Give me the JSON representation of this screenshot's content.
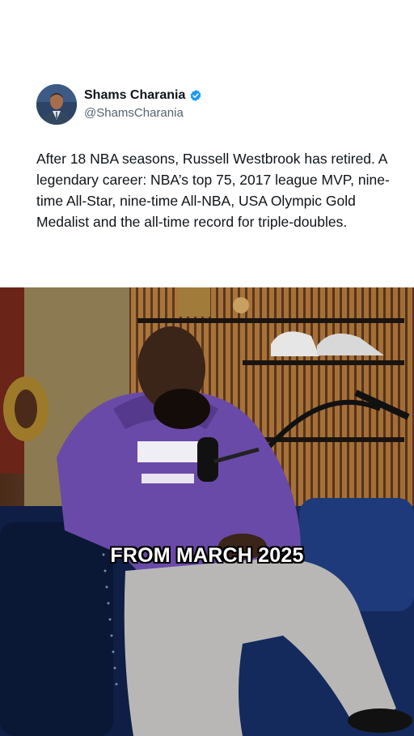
{
  "tweet": {
    "author_name": "Shams Charania",
    "author_handle": "@ShamsCharania",
    "verified": true,
    "text": "After 18 NBA seasons, Russell Westbrook has retired. A legendary career: NBA’s top 75, 2017 league MVP, nine-time All-Star, nine-time All-NBA, USA Olympic Gold Medalist and the all-time record for triple-doubles."
  },
  "video": {
    "caption": "FROM MARCH 2025"
  },
  "colors": {
    "verified_blue": "#1d9bf0",
    "hoodie_purple": "#6a4aa8",
    "couch_blue": "#1f3a7a"
  }
}
